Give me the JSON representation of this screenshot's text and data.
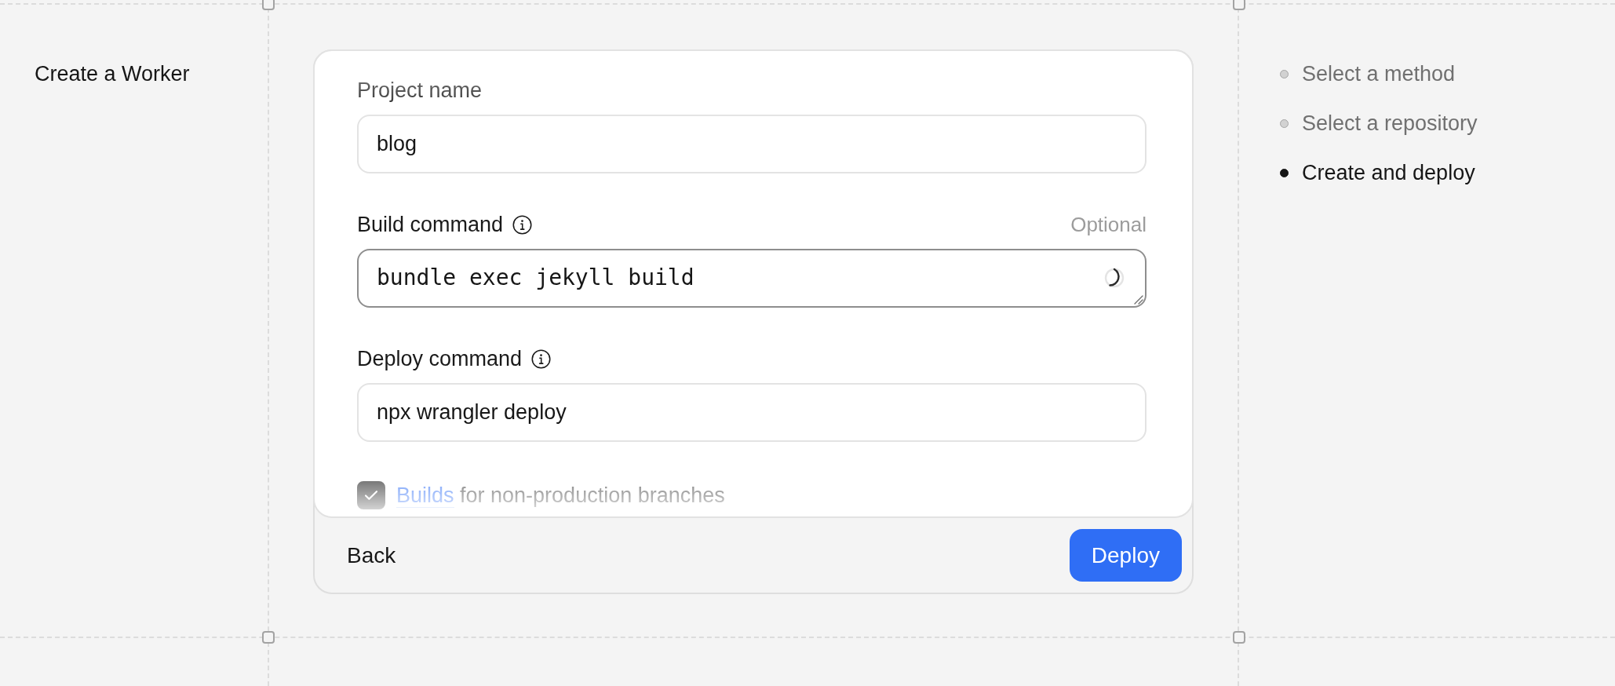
{
  "page": {
    "title": "Create a Worker"
  },
  "form": {
    "fields": [
      {
        "kind": "input",
        "label": "Project name",
        "info": false,
        "value": "blog",
        "focused": false
      },
      {
        "kind": "textarea",
        "label": "Build command",
        "info": true,
        "optional": "Optional",
        "value": "bundle exec jekyll build",
        "focused": true,
        "loading": true
      },
      {
        "kind": "input",
        "label": "Deploy command",
        "info": true,
        "value": "npx wrangler deploy",
        "focused": false
      }
    ],
    "checkbox": {
      "checked": true,
      "link": "Builds",
      "label": "for non-production branches"
    },
    "actions": {
      "back": "Back",
      "deploy": "Deploy"
    }
  },
  "steps": [
    {
      "label": "Select a method",
      "selected": false
    },
    {
      "label": "Select a repository",
      "selected": false
    },
    {
      "label": "Create and deploy",
      "selected": true
    }
  ]
}
